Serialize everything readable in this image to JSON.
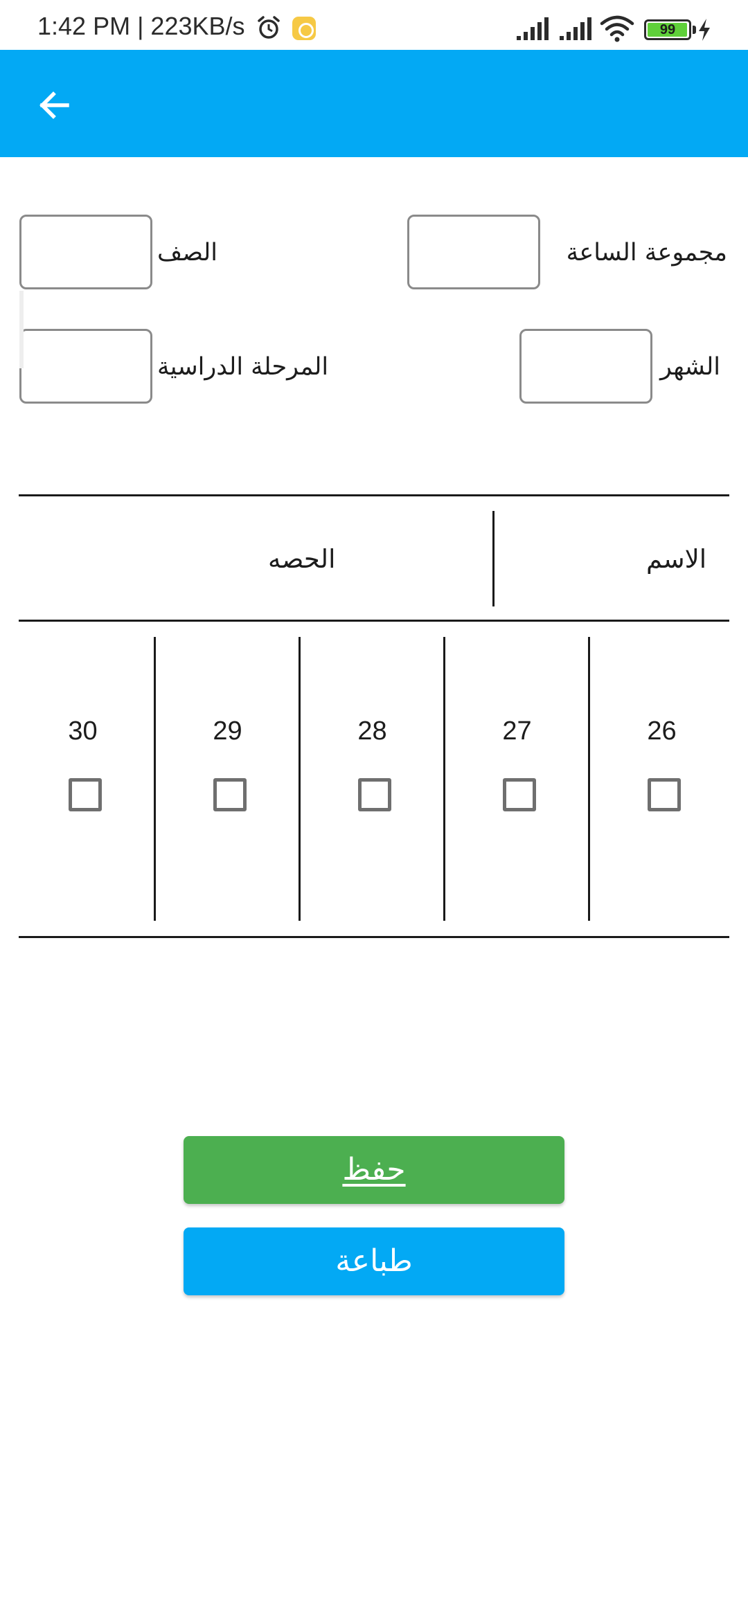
{
  "status_bar": {
    "time_speed": "1:42 PM | 223KB/s",
    "battery_level": "99",
    "icons": [
      "alarm-icon",
      "notification-icon",
      "signal-icon",
      "signal-icon",
      "wifi-icon",
      "battery-icon",
      "charging-icon"
    ]
  },
  "app_bar": {
    "color": "#03a9f4",
    "back_icon": "arrow-left-icon"
  },
  "form": {
    "hour_group": {
      "label": "مجموعة الساعة",
      "value": ""
    },
    "grade": {
      "label": "الصف",
      "value": ""
    },
    "month": {
      "label": "الشهر",
      "value": ""
    },
    "stage": {
      "label": "المرحلة الدراسية",
      "value": ""
    }
  },
  "table": {
    "name_header": "الاسم",
    "session_header": "الحصه",
    "days": [
      {
        "day": "26",
        "checked": false
      },
      {
        "day": "27",
        "checked": false
      },
      {
        "day": "28",
        "checked": false
      },
      {
        "day": "29",
        "checked": false
      },
      {
        "day": "30",
        "checked": false
      }
    ]
  },
  "buttons": {
    "save_label": "حفظ",
    "save_color": "#4caf50",
    "print_label": "طباعة",
    "print_color": "#03a9f4"
  }
}
